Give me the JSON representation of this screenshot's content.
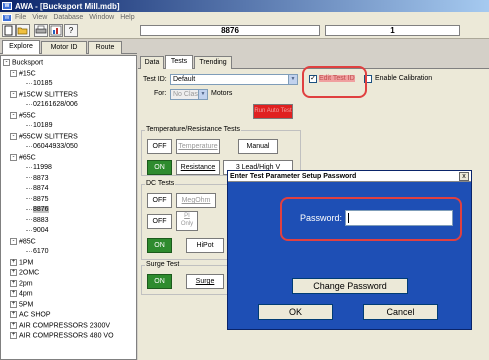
{
  "window": {
    "icon": "app-icon",
    "title": "AWA - [Bucksport Mill.mdb]"
  },
  "menu": {
    "items": [
      "File",
      "View",
      "Database",
      "Window",
      "Help"
    ]
  },
  "toolbar": {
    "icons": [
      "new-icon",
      "open-icon",
      "print-icon",
      "chart-icon",
      "help-icon"
    ],
    "motor_field": "8876",
    "index_field": "1"
  },
  "left_tabs": [
    "Explore",
    "Motor ID",
    "Route"
  ],
  "tree": [
    {
      "label": "Bucksport",
      "exp": "-",
      "indent": 0
    },
    {
      "label": "#15C",
      "exp": "-",
      "indent": 1
    },
    {
      "label": "10185",
      "exp": "",
      "indent": 2
    },
    {
      "label": "#15CW SLITTERS",
      "exp": "-",
      "indent": 1
    },
    {
      "label": "02161628/006",
      "exp": "",
      "indent": 2
    },
    {
      "label": "#55C",
      "exp": "-",
      "indent": 1
    },
    {
      "label": "10189",
      "exp": "",
      "indent": 2
    },
    {
      "label": "#55CW SLITTERS",
      "exp": "-",
      "indent": 1
    },
    {
      "label": "06044933/050",
      "exp": "",
      "indent": 2
    },
    {
      "label": "#65C",
      "exp": "-",
      "indent": 1
    },
    {
      "label": "11998",
      "exp": "",
      "indent": 2
    },
    {
      "label": "8873",
      "exp": "",
      "indent": 2
    },
    {
      "label": "8874",
      "exp": "",
      "indent": 2
    },
    {
      "label": "8875",
      "exp": "",
      "indent": 2
    },
    {
      "label": "8876",
      "exp": "",
      "indent": 2,
      "selected": true
    },
    {
      "label": "8883",
      "exp": "",
      "indent": 2
    },
    {
      "label": "9004",
      "exp": "",
      "indent": 2
    },
    {
      "label": "#85C",
      "exp": "-",
      "indent": 1
    },
    {
      "label": "6170",
      "exp": "",
      "indent": 2
    },
    {
      "label": "1PM",
      "exp": "+",
      "indent": 1
    },
    {
      "label": "2OMC",
      "exp": "+",
      "indent": 1
    },
    {
      "label": "2pm",
      "exp": "+",
      "indent": 1
    },
    {
      "label": "4pm",
      "exp": "+",
      "indent": 1
    },
    {
      "label": "5PM",
      "exp": "+",
      "indent": 1
    },
    {
      "label": "AC SHOP",
      "exp": "+",
      "indent": 1
    },
    {
      "label": "AIR COMPRESSORS 2300V",
      "exp": "+",
      "indent": 1
    },
    {
      "label": "AIR COMPRESSORS 480 VO",
      "exp": "+",
      "indent": 1
    }
  ],
  "right_tabs": [
    "Data",
    "Tests",
    "Trending"
  ],
  "tests": {
    "test_id_label": "Test ID:",
    "test_id_value": "Default",
    "edit_test_id_label": "Edit Test ID",
    "edit_test_id_checked": true,
    "enable_calibration_label": "Enable Calibration",
    "enable_calibration_checked": false,
    "for_label": "For:",
    "for_value": "No Class",
    "motors_label": "Motors",
    "run_auto_test_label": "Run Auto Test"
  },
  "temp_group": {
    "title": "Temperature/Resistance Tests",
    "off": "OFF",
    "temperature": "Temperature",
    "manual": "Manual",
    "on": "ON",
    "resistance": "Resistance",
    "lead_high": "3 Lead/High V"
  },
  "dc_group": {
    "title": "DC Tests",
    "off1": "OFF",
    "megohm": "MegOhm",
    "off2": "OFF",
    "pi_only_line1": "PI",
    "pi_only_line2": "Only",
    "on": "ON",
    "hipot": "HiPot"
  },
  "surge_group": {
    "title": "Surge Test",
    "on": "ON",
    "surge": "Surge"
  },
  "dialog": {
    "title": "Enter Test Parameter Setup Password",
    "close": "x",
    "password_label": "Password:",
    "password_value": "",
    "change_password": "Change Password",
    "ok": "OK",
    "cancel": "Cancel"
  },
  "colors": {
    "annotation_red": "#e04040",
    "dialog_blue": "#1e4fb5",
    "on_green": "#2e8b2e"
  }
}
